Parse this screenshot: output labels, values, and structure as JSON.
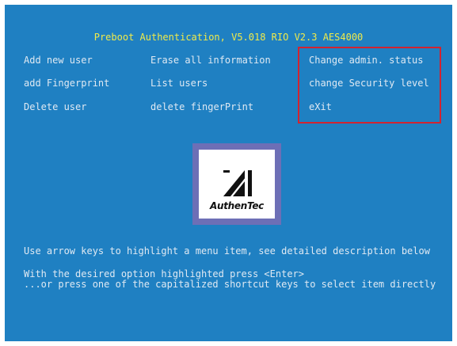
{
  "header": {
    "title": "Preboot Authentication, V5.018 RIO V2.3 AES4000"
  },
  "menu": {
    "col1": [
      "Add new user",
      "add Fingerprint",
      "Delete user"
    ],
    "col2": [
      "Erase all information",
      "List users",
      "delete fingerPrint"
    ],
    "col3": [
      "Change admin. status",
      "change Security level",
      "eXit"
    ]
  },
  "logo": {
    "text": "AuthenTec"
  },
  "help": {
    "line1": "Use arrow keys to highlight a menu item, see detailed description below",
    "line2": "With the desired option highlighted press <Enter>",
    "line3": "...or press one of the capitalized shortcut keys to select item directly"
  },
  "colors": {
    "background": "#1f80c2",
    "title": "#f0ea4a",
    "text": "#dfe9f3",
    "highlight_border": "#d22330",
    "logo_frame": "#6d6fb6"
  }
}
